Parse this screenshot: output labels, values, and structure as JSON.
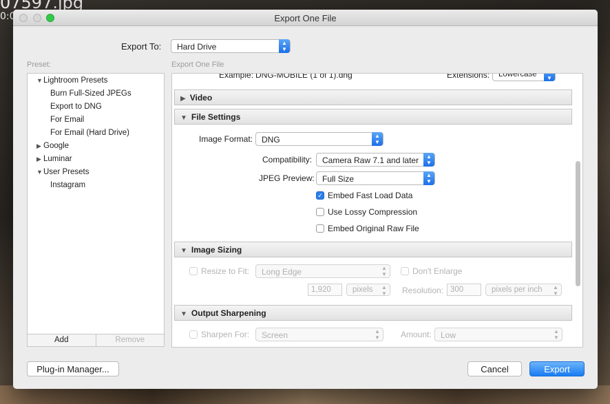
{
  "background": {
    "filename_fragment": "07597.jpg",
    "time_fragment": "0:0"
  },
  "window": {
    "title": "Export One File"
  },
  "export_to": {
    "label": "Export To:",
    "value": "Hard Drive"
  },
  "captions": {
    "preset": "Preset:",
    "export_one_file": "Export One File"
  },
  "presets": {
    "groups": [
      {
        "label": "Lightroom Presets",
        "expanded": true,
        "items": [
          "Burn Full-Sized JPEGs",
          "Export to DNG",
          "For Email",
          "For Email (Hard Drive)"
        ]
      },
      {
        "label": "Google",
        "expanded": false
      },
      {
        "label": "Luminar",
        "expanded": false
      },
      {
        "label": "User Presets",
        "expanded": true,
        "items": [
          "Instagram"
        ]
      }
    ],
    "add_label": "Add",
    "remove_label": "Remove"
  },
  "file_naming": {
    "example_label": "Example:",
    "example_value": "DNG-MOBILE (1 of 1).dng",
    "extensions_label": "Extensions:",
    "extensions_value": "Lowercase"
  },
  "video": {
    "header": "Video"
  },
  "file_settings": {
    "header": "File Settings",
    "image_format_label": "Image Format:",
    "image_format_value": "DNG",
    "compatibility_label": "Compatibility:",
    "compatibility_value": "Camera Raw 7.1 and later",
    "jpeg_preview_label": "JPEG Preview:",
    "jpeg_preview_value": "Full Size",
    "embed_fast_load": {
      "label": "Embed Fast Load Data",
      "checked": true
    },
    "lossy_compression": {
      "label": "Use Lossy Compression",
      "checked": false
    },
    "embed_original_raw": {
      "label": "Embed Original Raw File",
      "checked": false
    }
  },
  "image_sizing": {
    "header": "Image Sizing",
    "resize_label": "Resize to Fit:",
    "resize_value": "Long Edge",
    "dont_enlarge_label": "Don't Enlarge",
    "size_value": "1,920",
    "size_unit": "pixels",
    "resolution_label": "Resolution:",
    "resolution_value": "300",
    "resolution_unit": "pixels per inch"
  },
  "output_sharpening": {
    "header": "Output Sharpening",
    "sharpen_for_label": "Sharpen For:",
    "sharpen_for_value": "Screen",
    "amount_label": "Amount:",
    "amount_value": "Low"
  },
  "buttons": {
    "plugin_manager": "Plug-in Manager...",
    "cancel": "Cancel",
    "export": "Export"
  },
  "colors": {
    "accent": "#1c6fe8",
    "zoom_green": "#34c84a"
  }
}
